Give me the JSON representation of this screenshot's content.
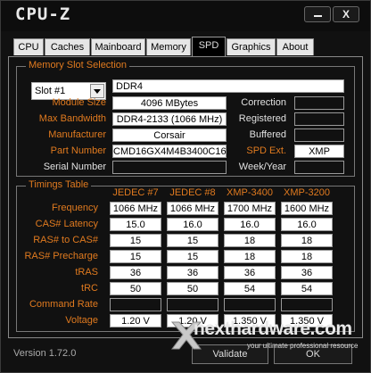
{
  "app": {
    "title": "CPU-Z",
    "version": "Version 1.72.0"
  },
  "tabs": [
    "CPU",
    "Caches",
    "Mainboard",
    "Memory",
    "SPD",
    "Graphics",
    "About"
  ],
  "memory_slot": {
    "group_label": "Memory Slot Selection",
    "slot": "Slot #1",
    "type": "DDR4",
    "module_size": {
      "label": "Module Size",
      "value": "4096 MBytes"
    },
    "max_bandwidth": {
      "label": "Max Bandwidth",
      "value": "DDR4-2133 (1066 MHz)"
    },
    "manufacturer": {
      "label": "Manufacturer",
      "value": "Corsair"
    },
    "part_number": {
      "label": "Part Number",
      "value": "CMD16GX4M4B3400C16"
    },
    "serial_number": {
      "label": "Serial Number",
      "value": ""
    },
    "correction": {
      "label": "Correction",
      "value": ""
    },
    "registered": {
      "label": "Registered",
      "value": ""
    },
    "buffered": {
      "label": "Buffered",
      "value": ""
    },
    "spd_ext": {
      "label": "SPD Ext.",
      "value": "XMP"
    },
    "week_year": {
      "label": "Week/Year",
      "value": ""
    }
  },
  "timings": {
    "group_label": "Timings Table",
    "columns": [
      "JEDEC #7",
      "JEDEC #8",
      "XMP-3400",
      "XMP-3200"
    ],
    "rows": [
      {
        "label": "Frequency",
        "values": [
          "1066 MHz",
          "1066 MHz",
          "1700 MHz",
          "1600 MHz"
        ]
      },
      {
        "label": "CAS# Latency",
        "values": [
          "15.0",
          "16.0",
          "16.0",
          "16.0"
        ]
      },
      {
        "label": "RAS# to CAS#",
        "values": [
          "15",
          "15",
          "18",
          "18"
        ]
      },
      {
        "label": "RAS# Precharge",
        "values": [
          "15",
          "15",
          "18",
          "18"
        ]
      },
      {
        "label": "tRAS",
        "values": [
          "36",
          "36",
          "36",
          "36"
        ]
      },
      {
        "label": "tRC",
        "values": [
          "50",
          "50",
          "54",
          "54"
        ]
      },
      {
        "label": "Command Rate",
        "values": [
          "",
          "",
          "",
          ""
        ]
      },
      {
        "label": "Voltage",
        "values": [
          "1.20 V",
          "1.20 V",
          "1.350 V",
          "1.350 V"
        ]
      }
    ]
  },
  "buttons": {
    "validate": "Validate",
    "ok": "OK",
    "close": "X"
  },
  "watermark": {
    "text": "nexthardware.com",
    "subtext": "your ultimate professional resource"
  },
  "colors": {
    "accent": "#e07a1f",
    "background": "#111111"
  }
}
